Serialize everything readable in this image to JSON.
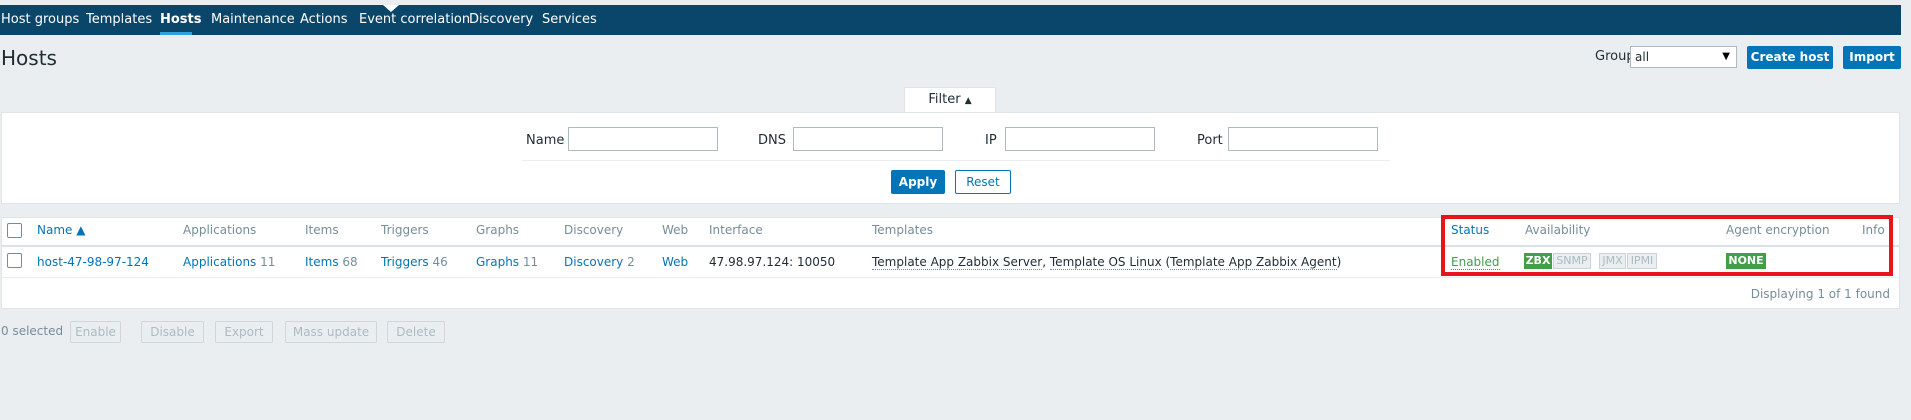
{
  "nav": {
    "items": [
      "Host groups",
      "Templates",
      "Hosts",
      "Maintenance",
      "Actions",
      "Event correlation",
      "Discovery",
      "Services"
    ],
    "active": "Hosts"
  },
  "header": {
    "title": "Hosts",
    "group_label": "Group",
    "group_value": "all",
    "create_host": "Create host",
    "import": "Import"
  },
  "filter": {
    "tab_label": "Filter",
    "fields": [
      {
        "label": "Name",
        "value": ""
      },
      {
        "label": "DNS",
        "value": ""
      },
      {
        "label": "IP",
        "value": ""
      },
      {
        "label": "Port",
        "value": ""
      }
    ],
    "apply": "Apply",
    "reset": "Reset"
  },
  "table": {
    "columns": [
      "Name ▲",
      "Applications",
      "Items",
      "Triggers",
      "Graphs",
      "Discovery",
      "Web",
      "Interface",
      "Templates",
      "Status",
      "Availability",
      "Agent encryption",
      "Info"
    ],
    "rows": [
      {
        "name": "host-47-98-97-124",
        "applications": "Applications",
        "applications_count": "11",
        "items": "Items",
        "items_count": "68",
        "triggers": "Triggers",
        "triggers_count": "46",
        "graphs": "Graphs",
        "graphs_count": "11",
        "discovery": "Discovery",
        "discovery_count": "2",
        "web": "Web",
        "interface": "47.98.97.124: 10050",
        "template_1": "Template App Zabbix Server",
        "template_2": "Template OS Linux",
        "template_3": "Template App Zabbix Agent",
        "status": "Enabled",
        "availability": [
          "ZBX",
          "SNMP",
          "JMX",
          "IPMI"
        ],
        "encryption": "NONE"
      }
    ],
    "footer": "Displaying 1 of 1 found"
  },
  "actions": {
    "selected": "0 selected",
    "buttons": [
      "Enable",
      "Disable",
      "Export",
      "Mass update",
      "Delete"
    ]
  },
  "colors": {
    "nav_bg": "#0a466a",
    "accent": "#0275b8",
    "enabled": "#429e47",
    "highlight": "#e8141b"
  }
}
